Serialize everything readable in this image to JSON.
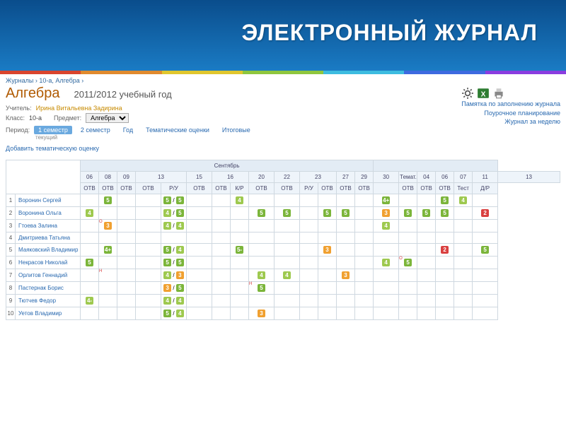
{
  "banner": {
    "title": "ЭЛЕКТРОННЫЙ ЖУРНАЛ"
  },
  "rainbow": [
    "#d9452e",
    "#e08a2e",
    "#e0c62e",
    "#8fc63d",
    "#3dbce0",
    "#3d6ae0",
    "#8a3de0"
  ],
  "breadcrumb": {
    "a": "Журналы",
    "b": "10-а, Алгебра"
  },
  "subject": "Алгебра",
  "year": "2011/2012 учебный год",
  "teacher": {
    "label": "Учитель:",
    "value": "Ирина Витальевна Задирина"
  },
  "class": {
    "label": "Класс:",
    "value": "10-а"
  },
  "subject_sel": {
    "label": "Предмет:",
    "value": "Алгебра"
  },
  "period": {
    "label": "Период:",
    "items": [
      "1 семестр",
      "2 семестр",
      "Год",
      "Тематические оценки",
      "Итоговые"
    ],
    "active": 0,
    "sub": "текущий"
  },
  "add_link": "Добавить тематическую оценку",
  "right_links": [
    "Памятка по заполнению журнала",
    "Поурочное планирование",
    "Журнал за неделю"
  ],
  "icons": [
    "settings-icon",
    "excel-icon",
    "print-icon"
  ],
  "table": {
    "month": "Сентябрь",
    "days": [
      "06",
      "08",
      "09",
      "13",
      "15",
      "16",
      "20",
      "22",
      "23",
      "27",
      "29",
      "30"
    ],
    "types": [
      "ОТВ",
      "ОТВ",
      "ОТВ",
      "ОТВ",
      "Р/У",
      "ОТВ",
      "ОТВ",
      "К/Р",
      "ОТВ",
      "ОТВ",
      "Р/У",
      "ОТВ",
      "ОТВ",
      "ОТВ"
    ],
    "right_head": [
      "Темат.",
      "04",
      "06",
      "07",
      "11",
      "13"
    ],
    "right_types": [
      "",
      "ОТВ",
      "ОТВ",
      "ОТВ",
      "Тест",
      "Д/Р"
    ],
    "students": [
      {
        "n": 1,
        "name": "Воронин Сергей",
        "cells": [
          "",
          "5",
          "",
          "",
          "5 / 5",
          "",
          "",
          "4",
          "",
          "",
          "",
          "",
          "",
          "",
          "4+",
          "",
          "",
          "5",
          "4",
          ""
        ]
      },
      {
        "n": 2,
        "name": "Воронина Ольга",
        "cells": [
          "4",
          "",
          "",
          "",
          "4 / 5",
          "",
          "",
          "",
          "5",
          "5",
          "",
          "5",
          "5",
          "",
          "3",
          "5",
          "5",
          "5",
          "",
          "2"
        ]
      },
      {
        "n": 3,
        "name": "Гтоева Залина",
        "cells": [
          "",
          "3",
          "",
          "",
          "4 / 4",
          "",
          "",
          "",
          "",
          "",
          "",
          "",
          "",
          "",
          "4",
          "",
          "",
          "",
          "",
          ""
        ],
        "corner": {
          "col": 1,
          "mark": "О"
        }
      },
      {
        "n": 4,
        "name": "Дмитриева Татьяна",
        "cells": [
          "",
          "",
          "",
          "",
          "",
          "",
          "",
          "",
          "",
          "",
          "",
          "",
          "",
          "",
          "",
          "",
          "",
          "",
          "",
          ""
        ]
      },
      {
        "n": 5,
        "name": "Маяковский Владимир",
        "cells": [
          "",
          "4+",
          "",
          "",
          "5 / 4",
          "",
          "",
          "5-",
          "",
          "",
          "",
          "3",
          "",
          "",
          "",
          "",
          "",
          "2",
          "",
          "5"
        ]
      },
      {
        "n": 6,
        "name": "Некрасов Николай",
        "cells": [
          "5",
          "",
          "",
          "",
          "5 / 5",
          "",
          "",
          "",
          "",
          "",
          "",
          "",
          "",
          "",
          "4",
          "5",
          "",
          "",
          "",
          ""
        ],
        "corner": {
          "col": 15,
          "mark": "О"
        }
      },
      {
        "n": 7,
        "name": "Орлитов Геннадий",
        "cells": [
          "",
          "",
          "",
          "",
          "4 / 3",
          "",
          "",
          "",
          "4",
          "4",
          "",
          "",
          "3",
          "",
          "",
          "",
          "",
          "",
          "",
          ""
        ],
        "corner": {
          "col": 1,
          "mark": "Н"
        }
      },
      {
        "n": 8,
        "name": "Пастернак Борис",
        "cells": [
          "",
          "",
          "",
          "",
          "3 / 5",
          "",
          "",
          "",
          "5",
          "",
          "",
          "",
          "",
          "",
          "",
          "",
          "",
          "",
          "",
          ""
        ],
        "corner": {
          "col": 8,
          "mark": "Н"
        }
      },
      {
        "n": 9,
        "name": "Тютчев Федор",
        "cells": [
          "4-",
          "",
          "",
          "",
          "4 / 4",
          "",
          "",
          "",
          "",
          "",
          "",
          "",
          "",
          "",
          "",
          "",
          "",
          "",
          "",
          ""
        ]
      },
      {
        "n": 10,
        "name": "Уетов Владимир",
        "cells": [
          "",
          "",
          "",
          "",
          "5 / 4",
          "",
          "",
          "",
          "3",
          "",
          "",
          "",
          "",
          "",
          "",
          "",
          "",
          "",
          "",
          ""
        ]
      }
    ]
  }
}
